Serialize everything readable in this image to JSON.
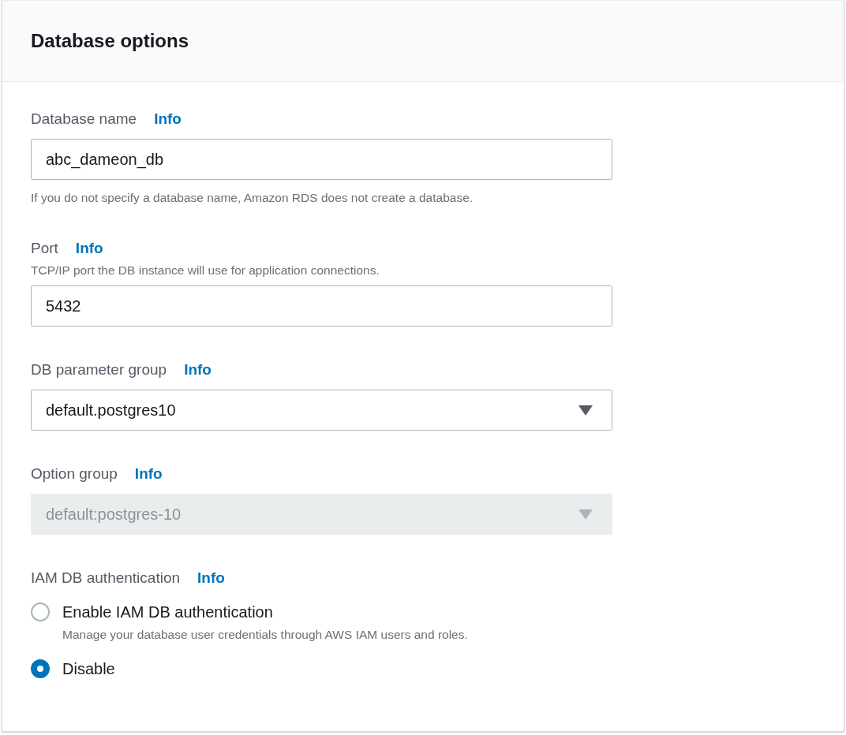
{
  "panel": {
    "title": "Database options"
  },
  "fields": [
    {
      "kind": "text",
      "label": "Database name",
      "info": "Info",
      "value": "abc_dameon_db",
      "hint": "If you do not specify a database name, Amazon RDS does not create a database.",
      "disabled": false
    },
    {
      "kind": "text",
      "label": "Port",
      "info": "Info",
      "description": "TCP/IP port the DB instance will use for application connections.",
      "value": "5432",
      "disabled": false
    },
    {
      "kind": "select",
      "label": "DB parameter group",
      "info": "Info",
      "value": "default.postgres10",
      "disabled": false
    },
    {
      "kind": "select",
      "label": "Option group",
      "info": "Info",
      "value": "default:postgres-10",
      "disabled": true
    }
  ],
  "iam": {
    "label": "IAM DB authentication",
    "info": "Info",
    "options": [
      {
        "label": "Enable IAM DB authentication",
        "description": "Manage your database user credentials through AWS IAM users and roles.",
        "selected": false
      },
      {
        "label": "Disable",
        "selected": true
      }
    ]
  }
}
